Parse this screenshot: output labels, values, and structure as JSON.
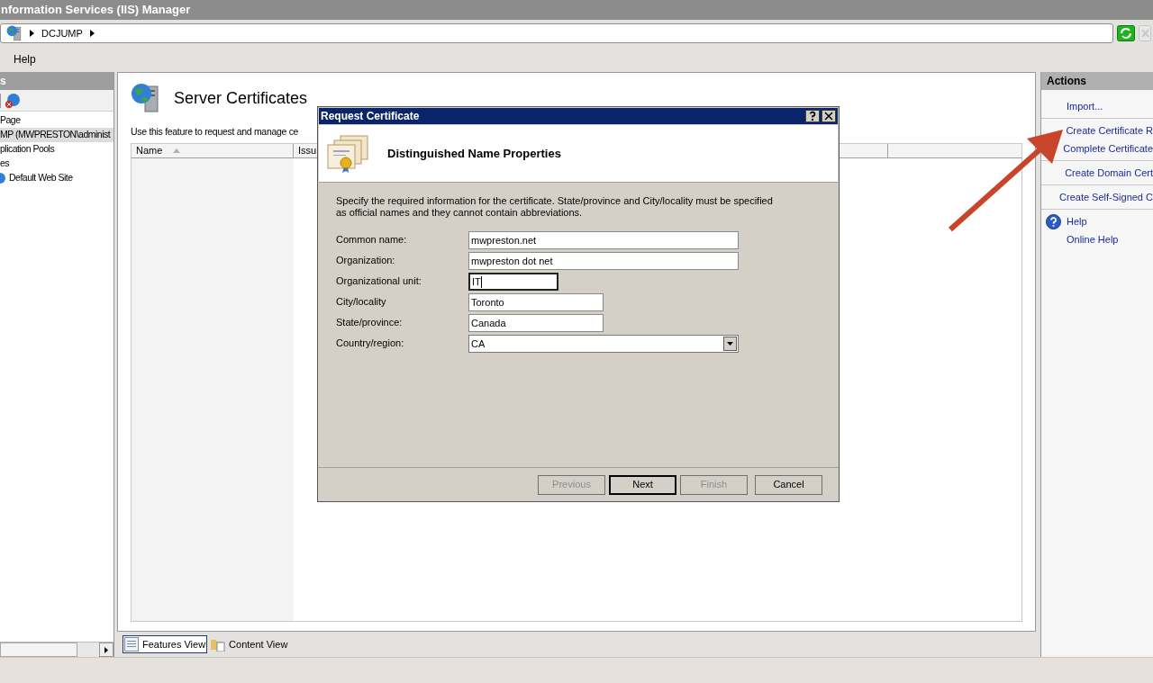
{
  "window": {
    "title": "nformation Services (IIS) Manager"
  },
  "address_bar": {
    "crumbs": [
      "DCJUMP"
    ]
  },
  "menu": [
    "Help"
  ],
  "connections": {
    "title": "s",
    "tree": [
      {
        "label": "Page",
        "selected": false
      },
      {
        "label": "MP (MWPRESTON\\administ",
        "selected": true,
        "children": [
          {
            "label": "plication Pools",
            "selected": false
          },
          {
            "label": "es",
            "selected": false,
            "children": [
              {
                "label": "Default Web Site",
                "selected": false
              }
            ]
          }
        ]
      }
    ]
  },
  "feature": {
    "title": "Server Certificates",
    "description": "Use this feature to request and manage ce",
    "columns": [
      {
        "label": "Name",
        "sorted": true
      },
      {
        "label": "Issu"
      }
    ]
  },
  "dialog": {
    "title": "Request Certificate",
    "heading": "Distinguished Name Properties",
    "instructions": "Specify the required information for the certificate. State/province and City/locality must be specified as official names and they cannot contain abbreviations.",
    "fields": [
      {
        "label": "Common name:",
        "value": "mwpreston.net",
        "kind": "text",
        "focused": false
      },
      {
        "label": "Organization:",
        "value": "mwpreston dot net",
        "kind": "text",
        "focused": false
      },
      {
        "label": "Organizational unit:",
        "value": "IT",
        "kind": "text",
        "focused": true
      },
      {
        "label": "City/locality",
        "value": "Toronto",
        "kind": "text",
        "focused": false
      },
      {
        "label": "State/province:",
        "value": "Canada",
        "kind": "text",
        "focused": false
      },
      {
        "label": "Country/region:",
        "value": "CA",
        "kind": "dropdown"
      }
    ],
    "buttons": [
      {
        "label": "Previous",
        "disabled": true,
        "default": false
      },
      {
        "label": "Next",
        "disabled": false,
        "default": true
      },
      {
        "label": "Finish",
        "disabled": true,
        "default": false
      },
      {
        "label": "Cancel",
        "disabled": false,
        "default": false
      }
    ]
  },
  "actions": {
    "title": "Actions",
    "groups": [
      [
        {
          "label": "Import...",
          "kind": "link"
        }
      ],
      [
        {
          "label": "Create Certificate R",
          "kind": "link"
        },
        {
          "label": "Complete Certificate",
          "kind": "link"
        }
      ],
      [
        {
          "label": "Create Domain Cert",
          "kind": "link"
        }
      ],
      [
        {
          "label": "Create Self-Signed C",
          "kind": "link"
        }
      ],
      [
        {
          "label": "Help",
          "kind": "help"
        },
        {
          "label": "Online Help",
          "kind": "link"
        }
      ]
    ]
  },
  "views": [
    {
      "label": "Features View",
      "selected": true
    },
    {
      "label": "Content View",
      "selected": false
    }
  ]
}
